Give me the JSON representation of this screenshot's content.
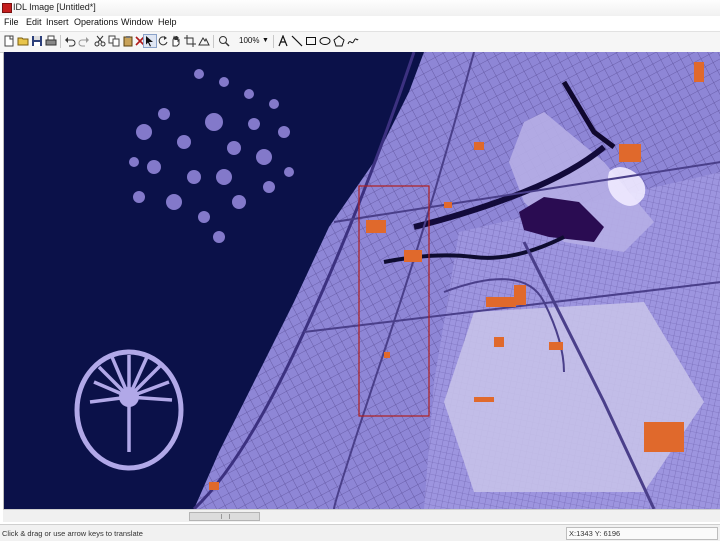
{
  "window": {
    "title": "IDL Image [Untitled*]"
  },
  "menu": {
    "items": [
      "File",
      "Edit",
      "Insert",
      "Operations",
      "Window",
      "Help"
    ]
  },
  "toolbar": {
    "zoom_value": "100%",
    "icons": [
      "new-icon",
      "open-icon",
      "save-icon",
      "print-icon",
      "undo-icon",
      "redo-icon",
      "cut-icon",
      "copy-icon",
      "paste-icon",
      "delete-icon",
      "select-arrow-icon",
      "rotate-icon",
      "hand-icon",
      "crop-icon",
      "mountain-icon",
      "pan-icon",
      "zoom-icon",
      "text-icon",
      "line-icon",
      "rectangle-icon",
      "ellipse-icon",
      "polygon-icon",
      "freehand-icon"
    ]
  },
  "status": {
    "left_text": "Click & drag or use arrow keys to translate",
    "coords_text": "X:1343  Y: 6196"
  },
  "image": {
    "description_colors": {
      "sea": "#0b1149",
      "land": "#8a7fd1",
      "roads": "#4a3f8a",
      "highlight": "#e0692c",
      "selection": "#b02020"
    }
  }
}
